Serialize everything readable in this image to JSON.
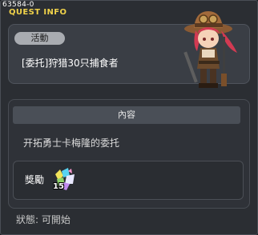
{
  "window": {
    "quest_id": "63584-0",
    "title": "QUEST INFO"
  },
  "quest": {
    "category_badge": "活動",
    "name": "[委托]狩猎30只捕食者"
  },
  "content": {
    "header": "內容",
    "description": "开拓勇士卡梅隆的委托"
  },
  "reward": {
    "label": "獎勵",
    "item_icon": "gem-cluster-icon",
    "quantity": "15"
  },
  "status": {
    "text": "狀態: 可開始"
  },
  "npc": {
    "portrait_icon": "cowgirl-npc-portrait"
  }
}
